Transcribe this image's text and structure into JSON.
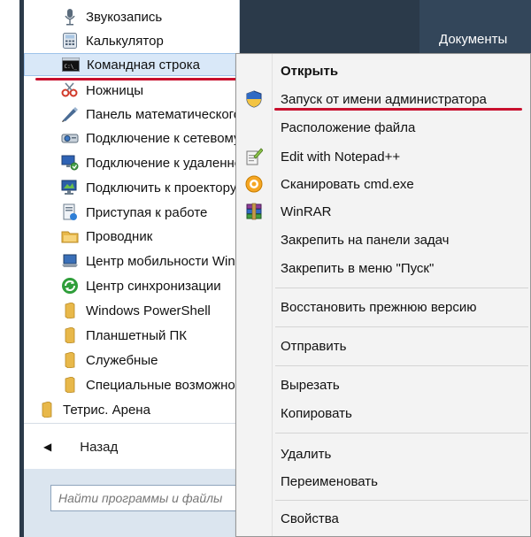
{
  "colors": {
    "highlight": "#d9e8f8",
    "annotation": "#c8102e",
    "folder": "#e8b84a"
  },
  "programs": [
    {
      "label": "Звукозапись",
      "icon": "microphone-icon"
    },
    {
      "label": "Калькулятор",
      "icon": "calculator-icon"
    },
    {
      "label": "Командная строка",
      "icon": "cmd-icon"
    },
    {
      "label": "Ножницы",
      "icon": "scissors-icon"
    },
    {
      "label": "Панель математического ввода",
      "icon": "math-panel-icon"
    },
    {
      "label": "Подключение к сетевому проектору",
      "icon": "network-projector-icon"
    },
    {
      "label": "Подключение к удаленному рабочему столу",
      "icon": "remote-desktop-icon"
    },
    {
      "label": "Подключить к проектору",
      "icon": "projector-icon"
    },
    {
      "label": "Приступая к работе",
      "icon": "getting-started-icon"
    },
    {
      "label": "Проводник",
      "icon": "explorer-icon"
    },
    {
      "label": "Центр мобильности Windows",
      "icon": "mobility-center-icon"
    },
    {
      "label": "Центр синхронизации",
      "icon": "sync-center-icon"
    },
    {
      "label": "Windows PowerShell",
      "icon": "folder-icon"
    },
    {
      "label": "Планшетный ПК",
      "icon": "folder-icon"
    },
    {
      "label": "Служебные",
      "icon": "folder-icon"
    },
    {
      "label": "Специальные возможности",
      "icon": "folder-icon"
    },
    {
      "label": "Тетрис. Арена",
      "icon": "folder-icon"
    }
  ],
  "back_label": "Назад",
  "search_placeholder": "Найти программы и файлы",
  "right_panel": {
    "documents": "Документы"
  },
  "context_menu": {
    "open": "Открыть",
    "run_as_admin": "Запуск от имени администратора",
    "file_location": "Расположение файла",
    "edit_notepad": "Edit with Notepad++",
    "scan": "Сканировать cmd.exe",
    "winrar": "WinRAR",
    "pin_taskbar": "Закрепить на панели задач",
    "pin_start": "Закрепить в меню \"Пуск\"",
    "restore": "Восстановить прежнюю версию",
    "send_to": "Отправить",
    "cut": "Вырезать",
    "copy": "Копировать",
    "delete": "Удалить",
    "rename": "Переименовать",
    "properties": "Свойства"
  }
}
